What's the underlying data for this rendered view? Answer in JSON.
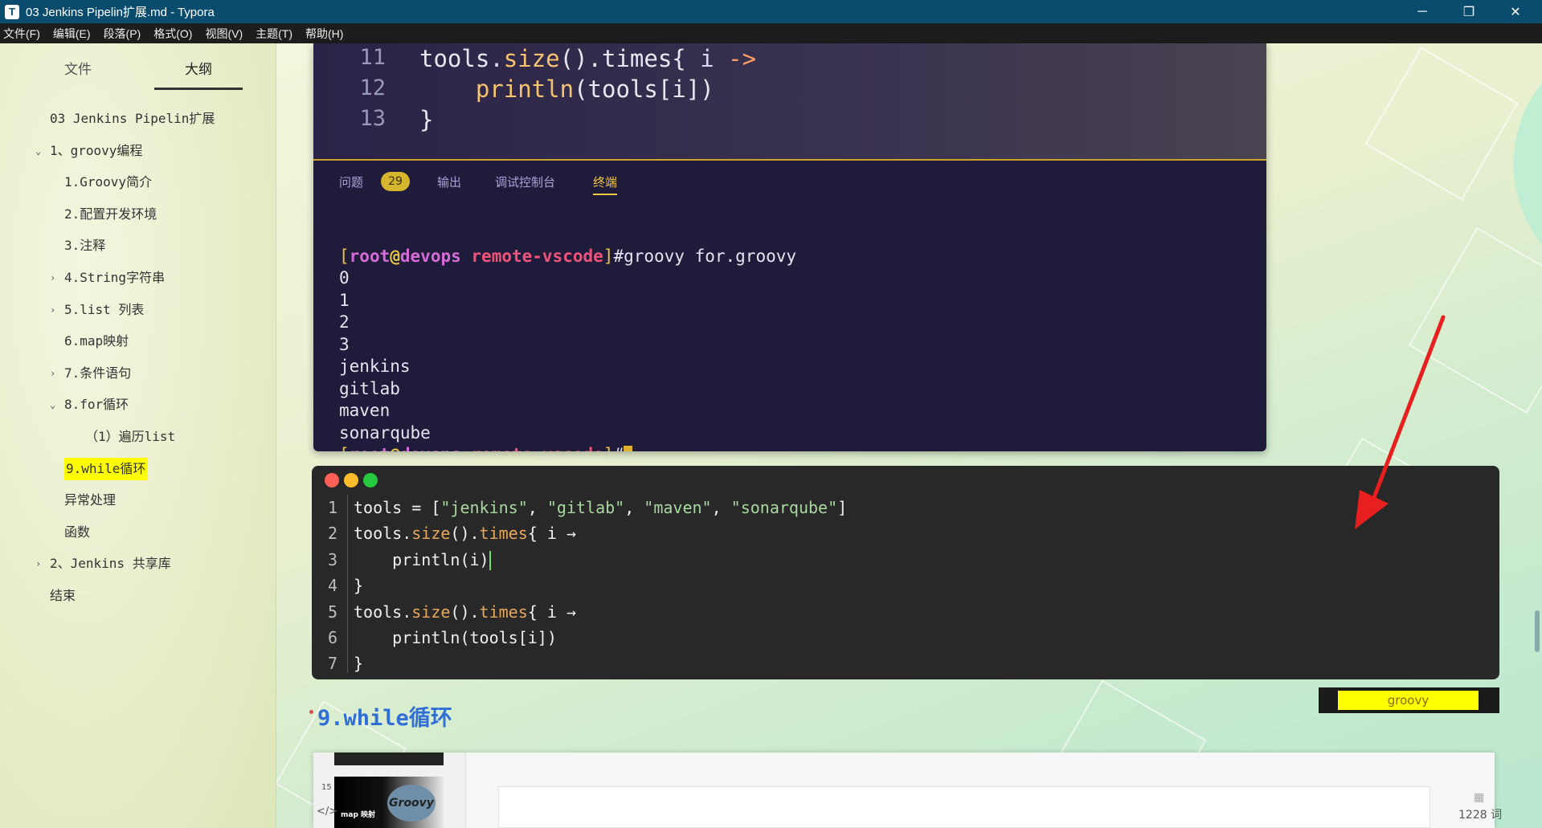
{
  "window": {
    "title": "03 Jenkins Pipelin扩展.md - Typora",
    "app_icon": "T",
    "controls": [
      "minimize",
      "restore",
      "close"
    ]
  },
  "menu": {
    "items": [
      "文件(F)",
      "编辑(E)",
      "段落(P)",
      "格式(O)",
      "视图(V)",
      "主题(T)",
      "帮助(H)"
    ]
  },
  "sidebar": {
    "tabs": [
      "文件",
      "大纲"
    ],
    "active_tab": "大纲",
    "outline": [
      {
        "label": "03 Jenkins Pipelin扩展",
        "level": 0,
        "chevron": ""
      },
      {
        "label": "1、groovy编程",
        "level": 0,
        "chevron": "⌄"
      },
      {
        "label": "1.Groovy简介",
        "level": 1,
        "chevron": ""
      },
      {
        "label": "2.配置开发环境",
        "level": 1,
        "chevron": ""
      },
      {
        "label": "3.注释",
        "level": 1,
        "chevron": ""
      },
      {
        "label": "4.String字符串",
        "level": 1,
        "chevron": "›"
      },
      {
        "label": "5.list 列表",
        "level": 1,
        "chevron": "›"
      },
      {
        "label": "6.map映射",
        "level": 1,
        "chevron": ""
      },
      {
        "label": "7.条件语句",
        "level": 1,
        "chevron": "›"
      },
      {
        "label": "8.for循环",
        "level": 1,
        "chevron": "⌄"
      },
      {
        "label": "（1）遍历list",
        "level": 2,
        "chevron": ""
      },
      {
        "label": "9.while循环",
        "level": 1,
        "chevron": "",
        "highlight": true
      },
      {
        "label": "异常处理",
        "level": 1,
        "chevron": ""
      },
      {
        "label": "函数",
        "level": 1,
        "chevron": ""
      },
      {
        "label": "2、Jenkins 共享库",
        "level": 0,
        "chevron": "›"
      },
      {
        "label": "结束",
        "level": 0,
        "chevron": ""
      }
    ],
    "collapse_icon": "‹"
  },
  "screenshot": {
    "editor_lines": [
      {
        "num": "11",
        "code_html": "tools<span class='id'>.</span><span class='fn'>size</span>().times{ <span class='id'>i</span> <span class='kw'>-></span>"
      },
      {
        "num": "12",
        "code_html": "    <span class='fn'>println</span>(tools[i])"
      },
      {
        "num": "13",
        "code_html": "}"
      }
    ],
    "panel_tabs": [
      {
        "label": "问题",
        "badge": "29"
      },
      {
        "label": "输出"
      },
      {
        "label": "调试控制台"
      },
      {
        "label": "终端",
        "active": true
      }
    ],
    "terminal": {
      "prompt_user": "root",
      "prompt_host": "devops",
      "prompt_dir": "remote-vscode",
      "command": "#groovy for.groovy",
      "output": [
        "0",
        "1",
        "2",
        "3",
        "jenkins",
        "gitlab",
        "maven",
        "sonarqube"
      ],
      "end_prompt_suffix": "#"
    }
  },
  "codeblock": {
    "language": "groovy",
    "lines": [
      {
        "num": "1",
        "html": "<span class='c-id'>tools</span> = [<span class='c-str'>\"jenkins\"</span>, <span class='c-str'>\"gitlab\"</span>, <span class='c-str'>\"maven\"</span>, <span class='c-str'>\"sonarqube\"</span>]"
      },
      {
        "num": "2",
        "html": "tools.<span class='c-fn'>size</span>().<span class='c-fn'>times</span>{ i →"
      },
      {
        "num": "3",
        "html": "    println(i)<span class='caret'></span>"
      },
      {
        "num": "4",
        "html": "}"
      },
      {
        "num": "5",
        "html": "tools.<span class='c-fn'>size</span>().<span class='c-fn'>times</span>{ i →"
      },
      {
        "num": "6",
        "html": "    println(tools[i])"
      },
      {
        "num": "7",
        "html": "}"
      }
    ],
    "traffic_light_colors": [
      "#ff5f56",
      "#ffbd2e",
      "#27c93f"
    ]
  },
  "heading": {
    "text": "9.while循环"
  },
  "embedded_ppt": {
    "slide_number": "15",
    "slide_label": "map 映射",
    "logo_text": "Groovy",
    "code_icon": "</>"
  },
  "status": {
    "word_count": "1228 词"
  },
  "colors": {
    "titlebar": "#0a4c6e",
    "heading": "#2f6fd6",
    "highlight": "#ffff00",
    "arrow": "#e81f1f"
  }
}
